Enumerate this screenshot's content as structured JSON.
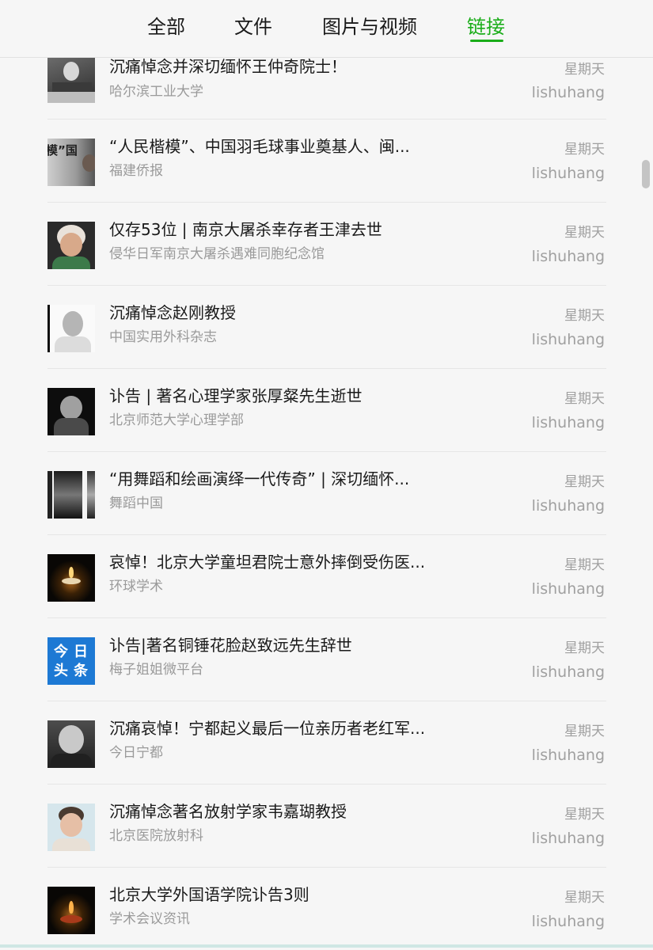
{
  "tabs": [
    {
      "label": "全部",
      "active": false
    },
    {
      "label": "文件",
      "active": false
    },
    {
      "label": "图片与视频",
      "active": false
    },
    {
      "label": "链接",
      "active": true
    }
  ],
  "accent_color": "#1aad19",
  "items": [
    {
      "title": "沉痛悼念并深切缅怀王仲奇院士！",
      "source": "哈尔滨工业大学",
      "day": "星期天",
      "author": "lishuhang",
      "thumb": "bw-photo-group"
    },
    {
      "title": "“人民楷模”、中国羽毛球事业奠基人、闽...",
      "source": "福建侨报",
      "day": "星期天",
      "author": "lishuhang",
      "thumb": "poster-photo",
      "thumb_text": "模”国"
    },
    {
      "title": "仅存53位 | 南京大屠杀幸存者王津去世",
      "source": "侵华日军南京大屠杀遇难同胞纪念馆",
      "day": "星期天",
      "author": "lishuhang",
      "thumb": "portrait-color"
    },
    {
      "title": "沉痛悼念赵刚教授",
      "source": "中国实用外科杂志",
      "day": "星期天",
      "author": "lishuhang",
      "thumb": "portrait-bw"
    },
    {
      "title": "讣告 | 著名心理学家张厚粲先生逝世",
      "source": "北京师范大学心理学部",
      "day": "星期天",
      "author": "lishuhang",
      "thumb": "portrait-bw-dark"
    },
    {
      "title": "“用舞蹈和绘画演绎一代传奇” | 深切缅怀...",
      "source": "舞蹈中国",
      "day": "星期天",
      "author": "lishuhang",
      "thumb": "film-strip"
    },
    {
      "title": "哀悼！北京大学童坦君院士意外摔倒受伤医...",
      "source": "环球学术",
      "day": "星期天",
      "author": "lishuhang",
      "thumb": "candle-icon"
    },
    {
      "title": "讣告|著名铜锤花脸赵致远先生辞世",
      "source": "梅子姐姐微平台",
      "day": "星期天",
      "author": "lishuhang",
      "thumb": "toutiao-logo",
      "thumb_text": [
        "今",
        "日",
        "头",
        "条"
      ]
    },
    {
      "title": "沉痛哀悼！宁都起义最后一位亲历者老红军...",
      "source": "今日宁都",
      "day": "星期天",
      "author": "lishuhang",
      "thumb": "portrait-bw"
    },
    {
      "title": "沉痛悼念著名放射学家韦嘉瑚教授",
      "source": "北京医院放射科",
      "day": "星期天",
      "author": "lishuhang",
      "thumb": "portrait-color-light"
    },
    {
      "title": "北京大学外国语学院讣告3则",
      "source": "学术会议资讯",
      "day": "星期天",
      "author": "lishuhang",
      "thumb": "candle-icon"
    }
  ]
}
